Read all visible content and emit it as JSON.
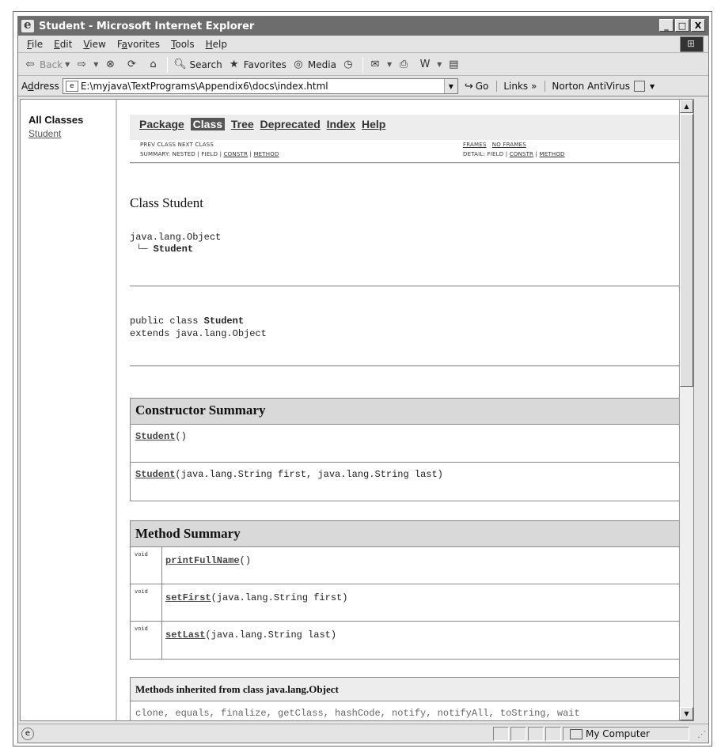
{
  "window": {
    "title": "Student - Microsoft Internet Explorer",
    "buttons": {
      "minimize": "_",
      "maximize": "□",
      "close": "X"
    }
  },
  "menu": [
    {
      "pre": "",
      "u": "F",
      "post": "ile"
    },
    {
      "pre": "",
      "u": "E",
      "post": "dit"
    },
    {
      "pre": "",
      "u": "V",
      "post": "iew"
    },
    {
      "pre": "F",
      "u": "a",
      "post": "vorites"
    },
    {
      "pre": "",
      "u": "T",
      "post": "ools"
    },
    {
      "pre": "",
      "u": "H",
      "post": "elp"
    }
  ],
  "toolbar": {
    "back": "Back",
    "search": "Search",
    "favorites": "Favorites",
    "media": "Media"
  },
  "address": {
    "label_pre": "A",
    "label_u": "d",
    "label_post": "dress",
    "url": "E:\\myjava\\TextPrograms\\Appendix6\\docs\\index.html",
    "go": "Go",
    "links": "Links »",
    "norton": "Norton AntiVirus"
  },
  "left_frame": {
    "heading": "All Classes",
    "classes": [
      "Student"
    ]
  },
  "navbar": {
    "package": "Package",
    "class": "Class",
    "tree": "Tree",
    "deprecated": "Deprecated",
    "index": "Index",
    "help": "Help"
  },
  "subnav": {
    "prev_next": "PREV CLASS  NEXT CLASS",
    "frames": "FRAMES",
    "no_frames": "NO FRAMES",
    "summary_prefix": "SUMMARY: NESTED | FIELD | ",
    "summary_constr": "CONSTR",
    "summary_sep": " | ",
    "summary_method": "METHOD",
    "detail_prefix": "DETAIL: FIELD | ",
    "detail_constr": "CONSTR",
    "detail_sep": " | ",
    "detail_method": "METHOD"
  },
  "class_doc": {
    "title": "Class Student",
    "superclass": "java.lang.Object",
    "tree_glyph": "└",
    "class_name": "Student",
    "decl_prefix": "public class ",
    "decl_name": "Student",
    "decl_extends": "extends java.lang.Object"
  },
  "constructor_summary": {
    "heading": "Constructor Summary",
    "rows": [
      {
        "name": "Student",
        "params": "()"
      },
      {
        "name": "Student",
        "params": "(java.lang.String first, java.lang.String last)"
      }
    ]
  },
  "method_summary": {
    "heading": "Method Summary",
    "rows": [
      {
        "type": "void",
        "name": "printFullName",
        "params": "()"
      },
      {
        "type": "void",
        "name": "setFirst",
        "params": "(java.lang.String first)"
      },
      {
        "type": "void",
        "name": "setLast",
        "params": "(java.lang.String last)"
      }
    ]
  },
  "inherited": {
    "heading": "Methods inherited from class java.lang.Object",
    "list": "clone, equals, finalize, getClass, hashCode, notify, notifyAll, toString, wait"
  },
  "status": {
    "zone": "My Computer"
  }
}
